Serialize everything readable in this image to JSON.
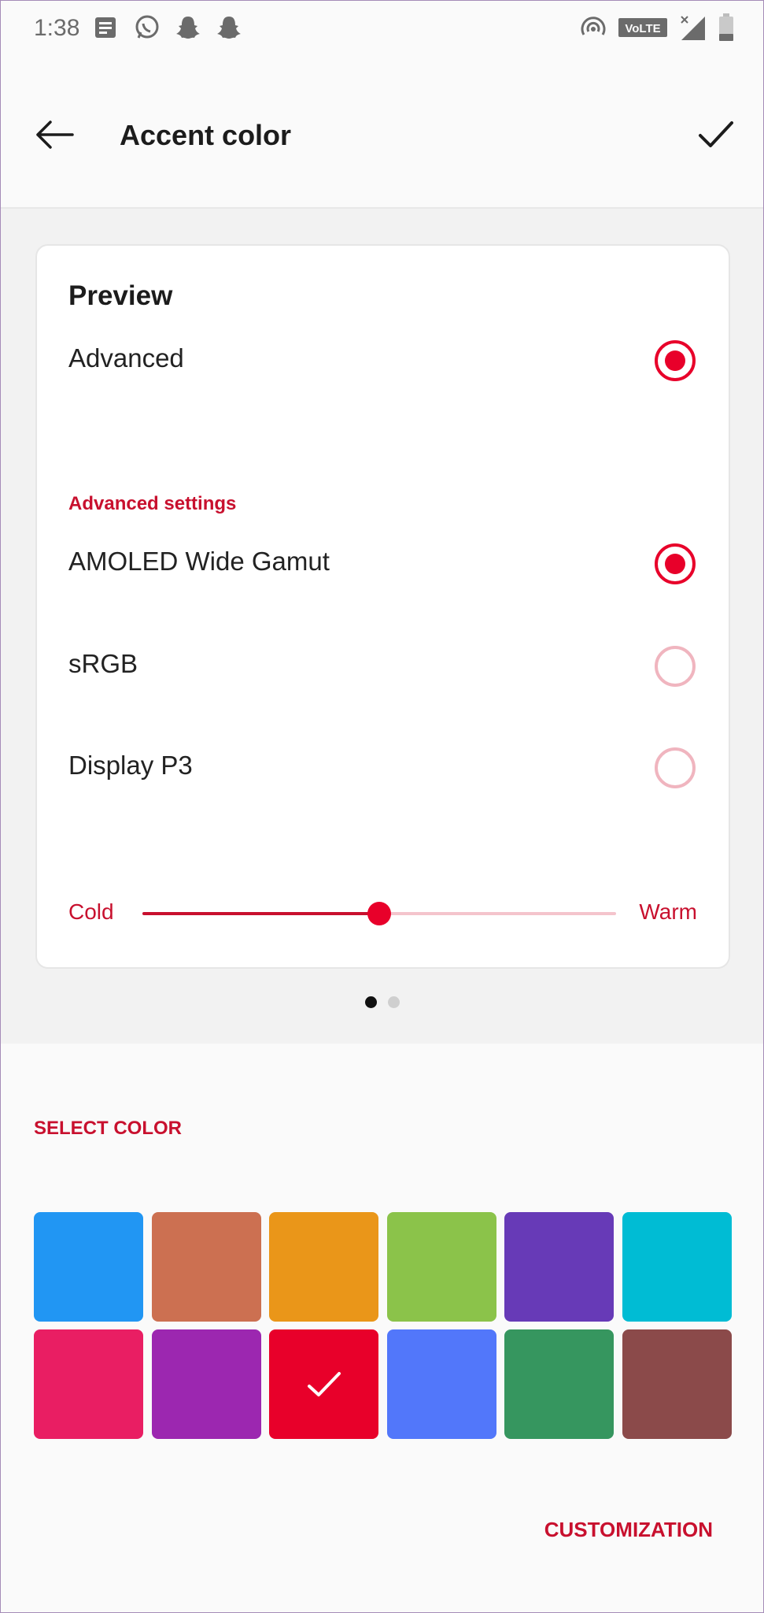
{
  "status_bar": {
    "time": "1:38",
    "left_icons": [
      "news-icon",
      "whatsapp-icon",
      "snapchat-icon",
      "snapchat-icon"
    ],
    "right_icons": [
      "hotspot-icon",
      "volte-icon",
      "signal-icon",
      "battery-icon"
    ],
    "volte_label": "VoLTE"
  },
  "app_bar": {
    "title": "Accent color",
    "back_icon": "arrow-left-icon",
    "confirm_icon": "check-icon"
  },
  "preview": {
    "title": "Preview",
    "options": [
      {
        "label": "Advanced",
        "selected": true
      }
    ],
    "section_label": "Advanced settings",
    "gamut_options": [
      {
        "label": "AMOLED Wide Gamut",
        "selected": true
      },
      {
        "label": "sRGB",
        "selected": false
      },
      {
        "label": "Display P3",
        "selected": false
      }
    ],
    "slider": {
      "min_label": "Cold",
      "max_label": "Warm",
      "value_percent": 50
    }
  },
  "pager": {
    "count": 2,
    "active_index": 0
  },
  "colors": {
    "section_label": "SELECT COLOR",
    "swatches": [
      {
        "name": "blue",
        "hex": "#2196f3",
        "selected": false
      },
      {
        "name": "terracotta",
        "hex": "#cc7051",
        "selected": false
      },
      {
        "name": "orange",
        "hex": "#ea9619",
        "selected": false
      },
      {
        "name": "light-green",
        "hex": "#8bc34a",
        "selected": false
      },
      {
        "name": "deep-purple",
        "hex": "#673ab7",
        "selected": false
      },
      {
        "name": "cyan",
        "hex": "#00bcd4",
        "selected": false
      },
      {
        "name": "pink",
        "hex": "#e91e63",
        "selected": false
      },
      {
        "name": "purple",
        "hex": "#9c27b0",
        "selected": false
      },
      {
        "name": "red",
        "hex": "#e8002a",
        "selected": true
      },
      {
        "name": "periwinkle",
        "hex": "#5277fa",
        "selected": false
      },
      {
        "name": "green",
        "hex": "#36965f",
        "selected": false
      },
      {
        "name": "brown",
        "hex": "#8b4a4a",
        "selected": false
      }
    ],
    "customization_label": "CUSTOMIZATION"
  },
  "theme": {
    "accent": "#e8002a",
    "accent_text": "#c8102e"
  }
}
